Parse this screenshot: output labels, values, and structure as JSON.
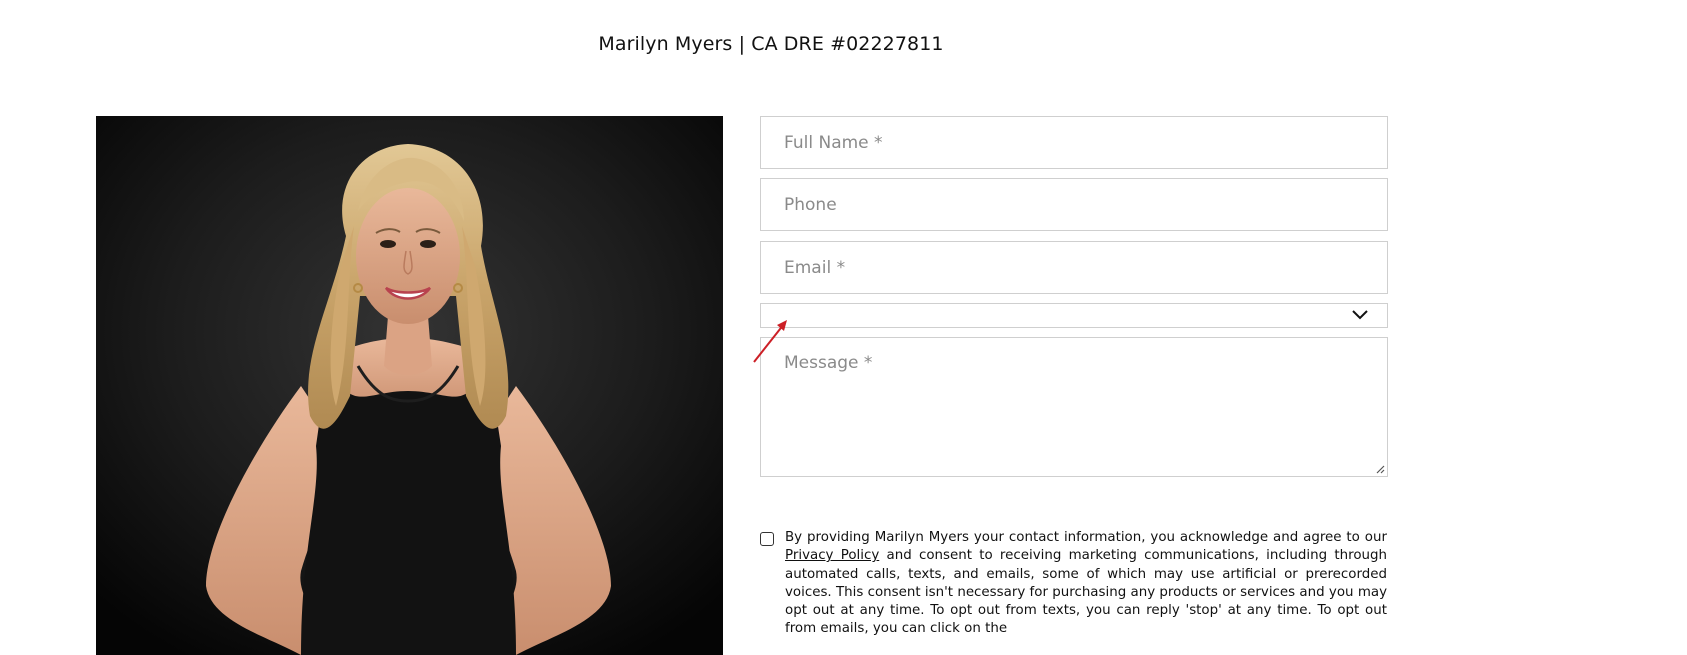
{
  "header": {
    "title": "Marilyn Myers | CA DRE #02227811"
  },
  "photo": {
    "alt": "Portrait of Marilyn Myers"
  },
  "form": {
    "full_name_placeholder": "Full Name *",
    "phone_placeholder": "Phone",
    "email_placeholder": "Email *",
    "select_value": "",
    "message_placeholder": "Message *"
  },
  "consent": {
    "text_before_link": "By providing Marilyn Myers your contact information, you acknowledge and agree to our ",
    "privacy_link": "Privacy Policy",
    "text_after_link": " and consent to receiving marketing communications, including through automated calls, texts, and emails, some of which may use artificial or prerecorded voices. This consent isn't necessary for purchasing any products or services and you may opt out at any time. To opt out from texts, you can reply 'stop' at any time. To opt out from emails, you can click on the"
  },
  "colors": {
    "annotation_arrow": "#cc1f26",
    "field_border": "#cfcfcf",
    "placeholder": "#8a8a8a"
  }
}
